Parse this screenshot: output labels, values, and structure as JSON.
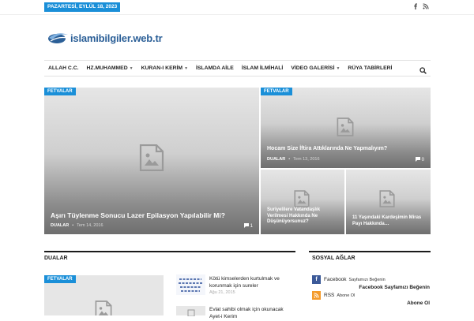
{
  "topbar": {
    "date": "PAZARTESİ, EYLÜL 18, 2023",
    "social_icons": [
      "facebook-icon",
      "rss-icon"
    ]
  },
  "logo": {
    "text": "islamibilgiler.web.tr"
  },
  "nav": {
    "items": [
      {
        "label": "ALLAH C.C.",
        "has_dropdown": false
      },
      {
        "label": "HZ.MUHAMMED",
        "has_dropdown": true
      },
      {
        "label": "KURAN-I KERİM",
        "has_dropdown": true
      },
      {
        "label": "İSLAMDA AİLE",
        "has_dropdown": false
      },
      {
        "label": "İSLAM İLMİHALİ",
        "has_dropdown": false
      },
      {
        "label": "VİDEO GALERİSİ",
        "has_dropdown": true
      },
      {
        "label": "RÜYA TABİRLERİ",
        "has_dropdown": false
      }
    ],
    "search_icon": "search-icon"
  },
  "featured": {
    "main": {
      "category": "FETVALAR",
      "title": "Aşırı Tüylenme Sonucu Lazer Epilasyon Yapılabilir Mi?",
      "author": "DUALAR",
      "date": "Tem 14, 2016",
      "comments": "1"
    },
    "top_right": {
      "category": "FETVALAR",
      "title": "Hocam Size İftira Attıklarında Ne Yapmalıyım?",
      "author": "DUALAR",
      "date": "Tem 13, 2016",
      "comments": "0"
    },
    "bottom_left": {
      "title": "Suriyelilere Vatandaşlık Verilmesi Hakkında Ne Düşünüyorsunuz?"
    },
    "bottom_right": {
      "title": "11 Yaşındaki Kardeşimin Miras Payı Hakkında…"
    }
  },
  "dualar": {
    "heading": "DUALAR",
    "main_category": "FETVALAR",
    "items": [
      {
        "title": "Kötü kimselerden kurtulmak ve korunmak için sureler",
        "date": "Ağu 21, 2015"
      },
      {
        "title": "Evlat sahibi olmak için okunacak Ayet-i Kerim",
        "date": ""
      }
    ]
  },
  "social": {
    "heading": "SOSYAL AĞLAR",
    "entries": [
      {
        "icon": "facebook-icon",
        "name": "Facebook",
        "sub": "Sayfamızı Beğenin",
        "action": "Facebook Sayfamızı Beğenin",
        "color": "#3b5998"
      },
      {
        "icon": "rss-icon",
        "name": "RSS",
        "sub": "Abone Ol",
        "action": "Abone Ol",
        "color": "#f49a2a"
      }
    ]
  },
  "colors": {
    "accent": "#1a8fd8",
    "dark": "#1b1b1b"
  }
}
